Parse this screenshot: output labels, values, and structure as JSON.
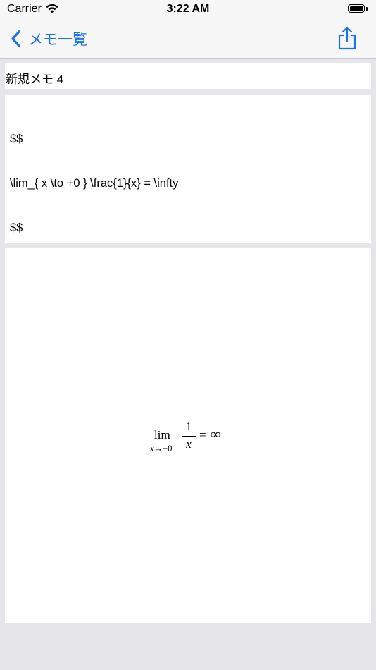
{
  "status_bar": {
    "carrier": "Carrier",
    "time": "3:22 AM"
  },
  "nav": {
    "back_label": "メモ一覧",
    "accent_color": "#1a73e8"
  },
  "memo": {
    "title": "新規メモ 4",
    "source_lines": [
      "$$",
      "\\lim_{ x \\to +0 } \\frac{1}{x} = \\infty",
      "$$"
    ]
  },
  "preview": {
    "lim": "lim",
    "sub_var": "x",
    "sub_arrow": "→",
    "sub_value": "+0",
    "numerator": "1",
    "denominator": "x",
    "equals": "=",
    "result": "∞"
  },
  "icons": {
    "signal": "wifi-icon",
    "battery": "battery-icon",
    "back": "chevron-left-icon",
    "share": "share-icon"
  }
}
